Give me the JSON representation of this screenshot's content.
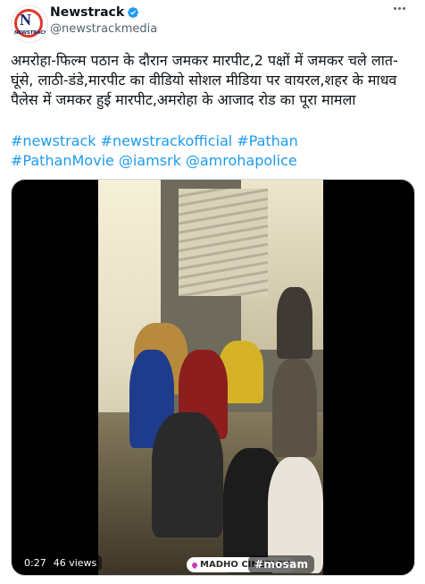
{
  "account": {
    "avatar_letter": "N",
    "avatar_brand": "NEWSTRACK",
    "display_name": "Newstrack",
    "handle": "@newstrackmedia",
    "verified": true,
    "verified_color": "#1d9bf0"
  },
  "more_icon": "more-horizontal-icon",
  "tweet": {
    "text": "अमरोहा-फिल्म पठान के दौरान जमकर मारपीट,2 पक्षों में जमकर चले लात-घूंसे, लाठी-डंडे,मारपीट का वीडियो सोशल मीडिया पर वायरल,शहर के माधव पैलेस में जमकर हुई मारपीट,अमरोहा के आजाद रोड का पूरा मामला",
    "hashtags": [
      "#newstrack",
      "#newstrackofficial",
      "#Pathan",
      "#PathanMovie",
      "@iamsrk",
      "@amrohapolice"
    ],
    "link_color": "#1d9bf0"
  },
  "media": {
    "duration": "0:27",
    "views": "46 views",
    "location_tag": "MADHO CINEPLEX",
    "watermark": "#mosam"
  }
}
